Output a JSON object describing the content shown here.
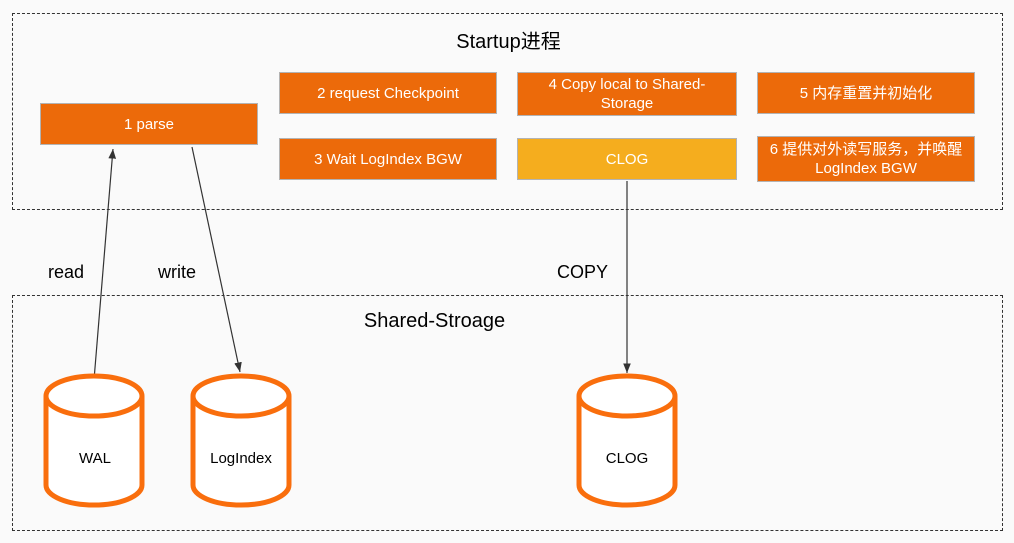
{
  "regions": {
    "startup": {
      "title": "Startup进程"
    },
    "shared": {
      "title": "Shared-Stroage"
    }
  },
  "boxes": {
    "parse": {
      "label": "1 parse",
      "color": "#ec6a0a"
    },
    "checkpoint": {
      "label": "2 request Checkpoint",
      "color": "#ec6a0a"
    },
    "waitlog": {
      "label": "3 Wait LogIndex BGW",
      "color": "#ec6a0a"
    },
    "copylocal": {
      "label": "4 Copy local to Shared-Storage",
      "color": "#ec6a0a"
    },
    "clog": {
      "label": "CLOG",
      "color": "#f5ad1e"
    },
    "meminit": {
      "label": "5 内存重置并初始化",
      "color": "#ec6a0a"
    },
    "serve": {
      "label": "6 提供对外读写服务，并唤醒LogIndex BGW",
      "color": "#ec6a0a"
    }
  },
  "edges": {
    "read": "read",
    "write": "write",
    "copy": "COPY"
  },
  "cylinders": {
    "wal": {
      "label": "WAL",
      "color": "#f96e0d"
    },
    "logindex": {
      "label": "LogIndex",
      "color": "#f96e0d"
    },
    "clog": {
      "label": "CLOG",
      "color": "#f96e0d"
    }
  },
  "colors": {
    "orange": "#ec6a0a",
    "amber": "#f5ad1e",
    "cylinder": "#f96e0d",
    "background": "#fafafa",
    "arrow": "#333333"
  }
}
